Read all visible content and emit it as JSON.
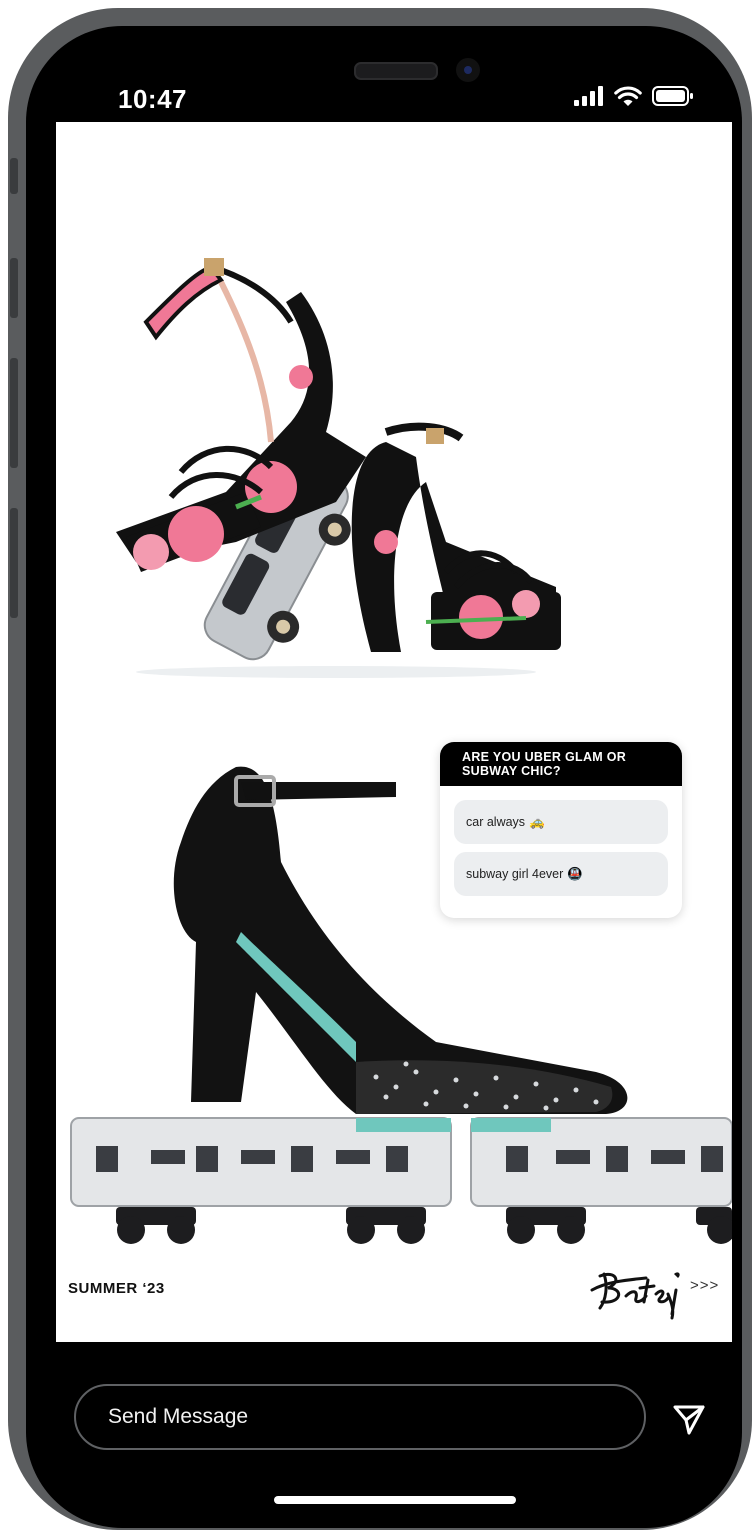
{
  "status_bar": {
    "time": "10:47",
    "icons": [
      "signal-icon",
      "wifi-icon",
      "battery-icon"
    ]
  },
  "story": {
    "poll": {
      "question": "ARE YOU UBER GLAM OR SUBWAY CHIC?",
      "options": [
        {
          "label": "car always",
          "emoji": "🚕"
        },
        {
          "label": "subway girl 4ever",
          "emoji": "🚇"
        }
      ]
    },
    "caption": "SUMMER ‘23",
    "brand_logo": "Betsey",
    "next_chevrons": ">>>"
  },
  "reply": {
    "placeholder": "Send Message",
    "send_icon": "send-icon"
  },
  "colors": {
    "frame": "#5a5c5e",
    "screen_bg": "#000000",
    "story_bg": "#ffffff",
    "poll_header": "#000000",
    "poll_option_bg": "#eceef0",
    "floral_pink": "#f07896",
    "metallic": "#c4c8cc",
    "teal": "#6fc7bd"
  }
}
